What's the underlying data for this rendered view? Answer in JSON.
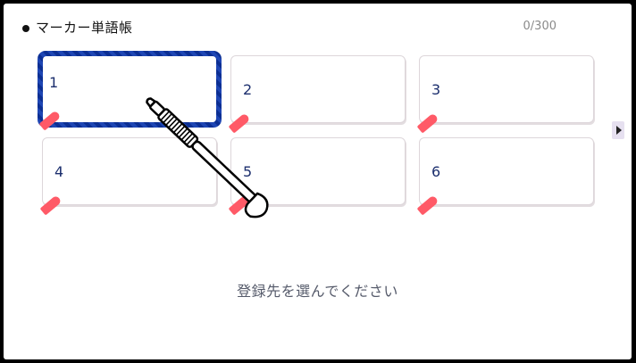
{
  "header": {
    "title": "マーカー単語帳",
    "counter": "0/300",
    "bullet_icon": "bullet-dot-icon"
  },
  "slots": [
    {
      "number": "1",
      "selected": true
    },
    {
      "number": "2",
      "selected": false
    },
    {
      "number": "3",
      "selected": false
    },
    {
      "number": "4",
      "selected": false
    },
    {
      "number": "5",
      "selected": false
    },
    {
      "number": "6",
      "selected": false
    }
  ],
  "side_arrow": {
    "icon": "arrow-right-icon"
  },
  "prompt": "登録先を選んでください",
  "cursor": {
    "icon": "stylus-pen-icon"
  },
  "colors": {
    "selection_border": "#0c2f93",
    "marker": "#ff5a67",
    "slot_number": "#1c2f6e",
    "prompt_text": "#555a6a"
  }
}
